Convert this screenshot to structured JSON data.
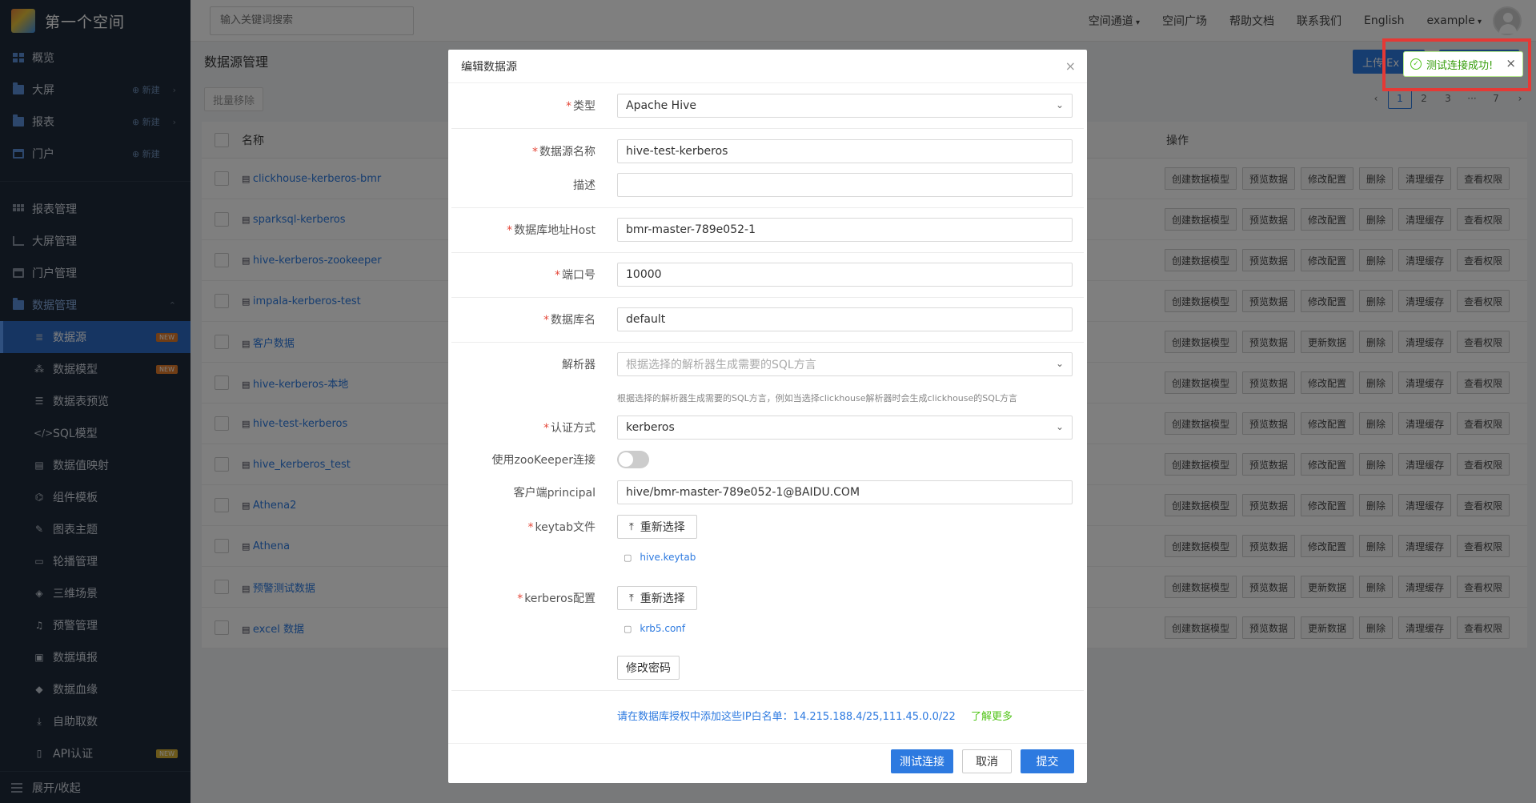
{
  "brand": {
    "name": "第一个空间"
  },
  "nav_top": [
    {
      "label": "概览",
      "icon": "grid-icon"
    },
    {
      "label": "大屏",
      "icon": "folder-icon",
      "new": "新建",
      "arrow": "›"
    },
    {
      "label": "报表",
      "icon": "folder-icon",
      "new": "新建",
      "arrow": "›"
    },
    {
      "label": "门户",
      "icon": "portal-icon",
      "new": "新建"
    }
  ],
  "nav_mgmt": [
    {
      "label": "报表管理",
      "icon": "table-grid-icon"
    },
    {
      "label": "大屏管理",
      "icon": "line-chart-icon"
    },
    {
      "label": "门户管理",
      "icon": "portal-icon"
    }
  ],
  "nav_data_section": {
    "label": "数据管理",
    "arrow": "⌃"
  },
  "nav_data_items": [
    {
      "label": "数据源",
      "icon": "database-icon",
      "glyph": "≣",
      "badge": "NEW"
    },
    {
      "label": "数据模型",
      "icon": "model-icon",
      "glyph": "⁂",
      "badge": "NEW"
    },
    {
      "label": "数据表预览",
      "icon": "list-icon",
      "glyph": "☰"
    },
    {
      "label": "SQL模型",
      "icon": "code-icon",
      "glyph": "</>"
    },
    {
      "label": "数据值映射",
      "icon": "book-icon",
      "glyph": "▤"
    },
    {
      "label": "组件模板",
      "icon": "component-icon",
      "glyph": "⌬"
    },
    {
      "label": "图表主题",
      "icon": "brush-icon",
      "glyph": "✎"
    },
    {
      "label": "轮播管理",
      "icon": "monitor-icon",
      "glyph": "▭"
    },
    {
      "label": "三维场景",
      "icon": "cube-icon",
      "glyph": "◈"
    },
    {
      "label": "预警管理",
      "icon": "bell-icon",
      "glyph": "♫"
    },
    {
      "label": "数据填报",
      "icon": "form-icon",
      "glyph": "▣"
    },
    {
      "label": "数据血缘",
      "icon": "lineage-icon",
      "glyph": "◆"
    },
    {
      "label": "自助取数",
      "icon": "download-icon",
      "glyph": "⤓"
    },
    {
      "label": "API认证",
      "icon": "api-icon",
      "glyph": "▯",
      "badge_y": "NEW"
    }
  ],
  "sidebar_footer": {
    "label": "展开/收起"
  },
  "topbar": {
    "search_placeholder": "输入关键词搜索",
    "links": [
      "空间通道",
      "空间广场",
      "帮助文档",
      "联系我们",
      "English",
      "example"
    ]
  },
  "page": {
    "title": "数据源管理",
    "upload_label": "上传 Ex",
    "bulk_remove": "批量移除",
    "pager": [
      "‹",
      "1",
      "2",
      "3",
      "···",
      "7",
      "›"
    ],
    "col_name": "名称",
    "col_ops": "操作"
  },
  "rows": [
    {
      "name": "clickhouse-kerberos-bmr",
      "ops": [
        "创建数据模型",
        "预览数据",
        "修改配置",
        "删除",
        "清理缓存",
        "查看权限"
      ]
    },
    {
      "name": "sparksql-kerberos",
      "ops": [
        "创建数据模型",
        "预览数据",
        "修改配置",
        "删除",
        "清理缓存",
        "查看权限"
      ]
    },
    {
      "name": "hive-kerberos-zookeeper",
      "ops": [
        "创建数据模型",
        "预览数据",
        "修改配置",
        "删除",
        "清理缓存",
        "查看权限"
      ]
    },
    {
      "name": "impala-kerberos-test",
      "ops": [
        "创建数据模型",
        "预览数据",
        "修改配置",
        "删除",
        "清理缓存",
        "查看权限"
      ]
    },
    {
      "name": "客户数据",
      "ops": [
        "创建数据模型",
        "预览数据",
        "更新数据",
        "删除",
        "清理缓存",
        "查看权限"
      ]
    },
    {
      "name": "hive-kerberos-本地",
      "ops": [
        "创建数据模型",
        "预览数据",
        "修改配置",
        "删除",
        "清理缓存",
        "查看权限"
      ]
    },
    {
      "name": "hive-test-kerberos",
      "ops": [
        "创建数据模型",
        "预览数据",
        "修改配置",
        "删除",
        "清理缓存",
        "查看权限"
      ]
    },
    {
      "name": "hive_kerberos_test",
      "ops": [
        "创建数据模型",
        "预览数据",
        "修改配置",
        "删除",
        "清理缓存",
        "查看权限"
      ]
    },
    {
      "name": "Athena2",
      "ops": [
        "创建数据模型",
        "预览数据",
        "修改配置",
        "删除",
        "清理缓存",
        "查看权限"
      ]
    },
    {
      "name": "Athena",
      "ops": [
        "创建数据模型",
        "预览数据",
        "修改配置",
        "删除",
        "清理缓存",
        "查看权限"
      ]
    },
    {
      "name": "预警测试数据",
      "ops": [
        "创建数据模型",
        "预览数据",
        "更新数据",
        "删除",
        "清理缓存",
        "查看权限"
      ]
    },
    {
      "name": "excel 数据",
      "ops": [
        "创建数据模型",
        "预览数据",
        "更新数据",
        "删除",
        "清理缓存",
        "查看权限"
      ]
    }
  ],
  "modal": {
    "title": "编辑数据源",
    "close": "×",
    "type_label": "类型",
    "type_value": "Apache Hive",
    "name_label": "数据源名称",
    "name_value": "hive-test-kerberos",
    "desc_label": "描述",
    "desc_value": "",
    "host_label": "数据库地址Host",
    "host_value": "bmr-master-789e052-1",
    "port_label": "端口号",
    "port_value": "10000",
    "db_label": "数据库名",
    "db_value": "default",
    "parser_label": "解析器",
    "parser_placeholder": "根据选择的解析器生成需要的SQL方言",
    "parser_hint": "根据选择的解析器生成需要的SQL方言，例如当选择clickhouse解析器时会生成clickhouse的SQL方言",
    "auth_label": "认证方式",
    "auth_value": "kerberos",
    "zk_label": "使用zooKeeper连接",
    "principal_label": "客户端principal",
    "principal_value": "hive/bmr-master-789e052-1@BAIDU.COM",
    "keytab_label": "keytab文件",
    "reselect": "重新选择",
    "keytab_file": "hive.keytab",
    "krb_label": "kerberos配置",
    "krb_file": "krb5.conf",
    "change_pwd": "修改密码",
    "whitelist": "请在数据库授权中添加这些IP白名单：14.215.188.4/25,111.45.0.0/22",
    "learn_more": "了解更多",
    "btn_test": "测试连接",
    "btn_cancel": "取消",
    "btn_submit": "提交"
  },
  "toast": {
    "text": "测试连接成功!",
    "close": "×"
  }
}
